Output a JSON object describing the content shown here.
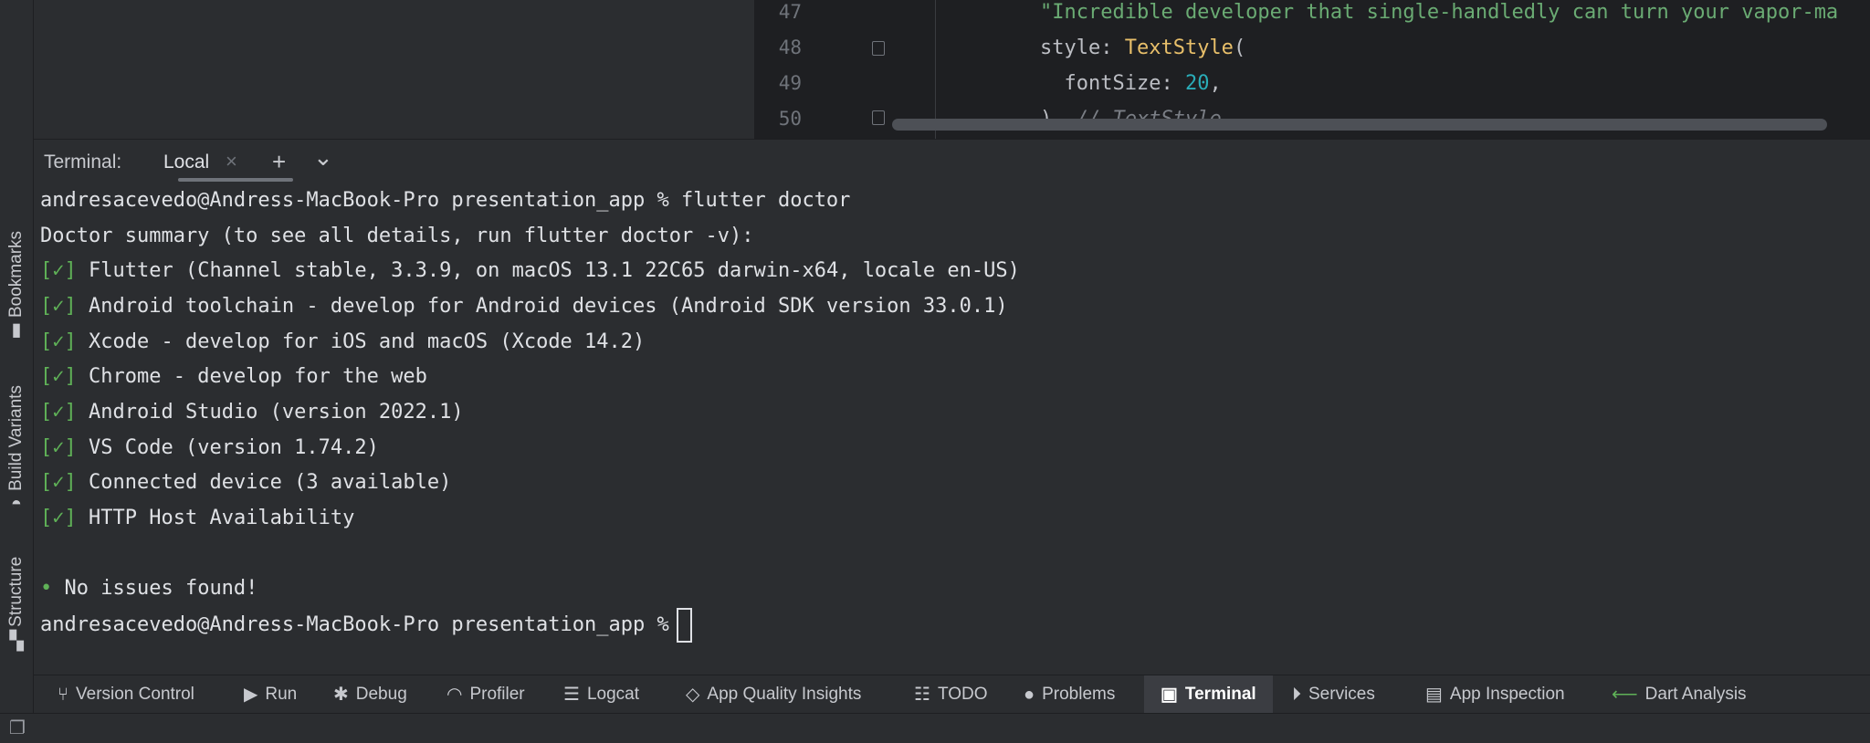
{
  "editor": {
    "line_numbers": [
      "47",
      "48",
      "49",
      "50"
    ],
    "lines": [
      {
        "text": "\"Incredible developer that single-handledly can turn your vapor-ma"
      },
      {
        "prefix": "style: ",
        "cls": "TextStyle",
        "suffix": "("
      },
      {
        "prefix": "  fontSize: ",
        "num": "20",
        "suffix": ","
      },
      {
        "prefix": "), ",
        "comment": "// TextStyle"
      }
    ]
  },
  "terminal_header": {
    "title": "Terminal:",
    "tab_label": "Local",
    "close": "×",
    "add": "+",
    "dropdown": "⌄"
  },
  "terminal": {
    "prompt_line": "andresacevedo@Andress-MacBook-Pro presentation_app % flutter doctor",
    "summary": "Doctor summary (to see all details, run flutter doctor -v):",
    "check_mark": "[✓]",
    "checks": [
      "Flutter (Channel stable, 3.3.9, on macOS 13.1 22C65 darwin-x64, locale en-US)",
      "Android toolchain - develop for Android devices (Android SDK version 33.0.1)",
      "Xcode - develop for iOS and macOS (Xcode 14.2)",
      "Chrome - develop for the web",
      "Android Studio (version 2022.1)",
      "VS Code (version 1.74.2)",
      "Connected device (3 available)",
      "HTTP Host Availability"
    ],
    "bullet": "•",
    "result": "No issues found!",
    "prompt": "andresacevedo@Andress-MacBook-Pro presentation_app %"
  },
  "side_tabs": {
    "bookmarks": "Bookmarks",
    "build_variants": "Build Variants",
    "structure": "Structure"
  },
  "toolbar": {
    "version_control": "Version Control",
    "run": "Run",
    "debug": "Debug",
    "profiler": "Profiler",
    "logcat": "Logcat",
    "app_quality": "App Quality Insights",
    "todo": "TODO",
    "problems": "Problems",
    "terminal": "Terminal",
    "services": "Services",
    "app_inspection": "App Inspection",
    "dart_analysis": "Dart Analysis"
  },
  "colors": {
    "background": "#2b2d30",
    "check_green": "#5fb157",
    "active_tab": "#3b3d42"
  }
}
